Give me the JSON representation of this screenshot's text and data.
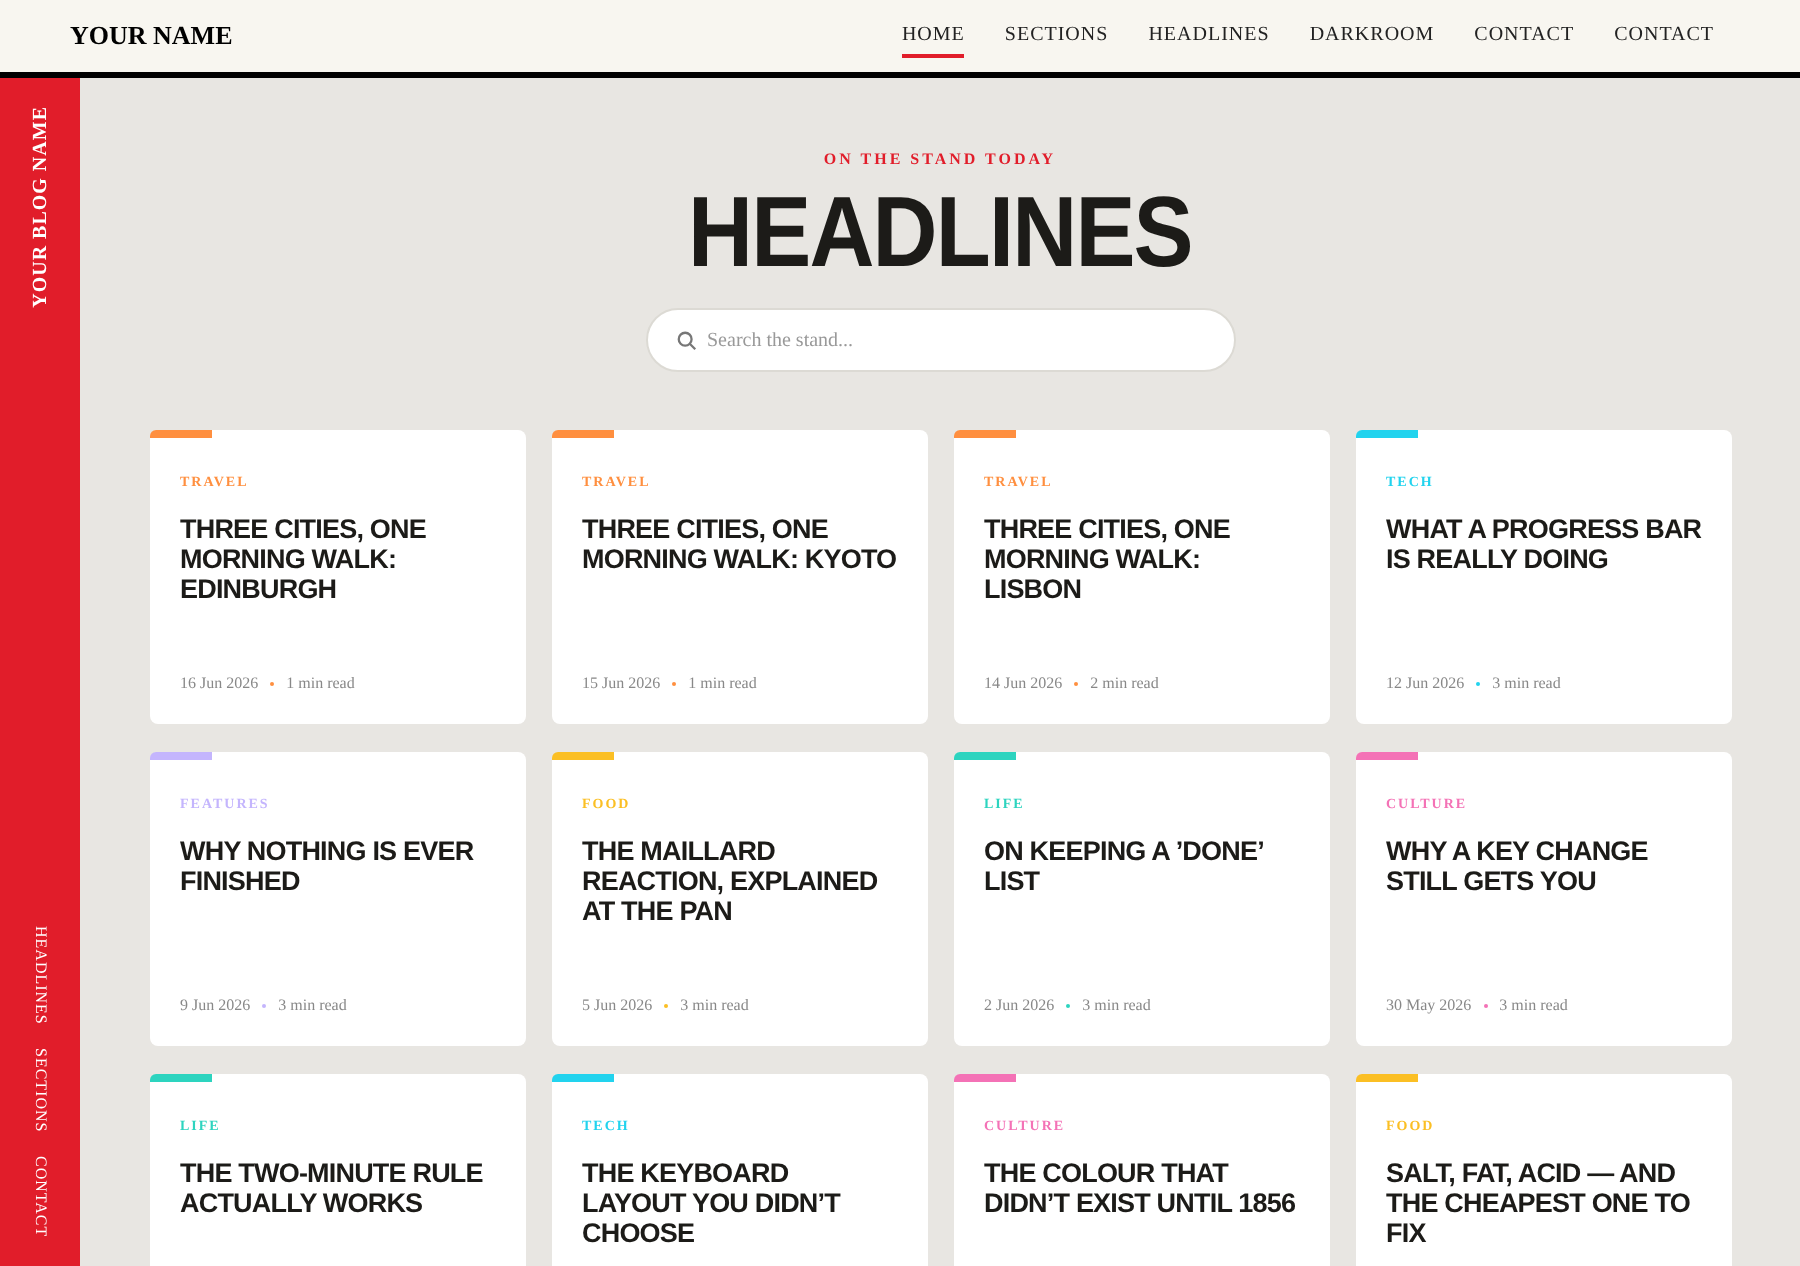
{
  "header": {
    "brand": "YOUR NAME",
    "nav": [
      {
        "label": "HOME",
        "selected": true
      },
      {
        "label": "SECTIONS",
        "selected": false
      },
      {
        "label": "HEADLINES",
        "selected": false
      },
      {
        "label": "DARKROOM",
        "selected": false
      },
      {
        "label": "CONTACT",
        "selected": false
      },
      {
        "label": "CONTACT",
        "selected": false
      }
    ]
  },
  "sidebar": {
    "blog_name": "YOUR BLOG NAME",
    "links": [
      "HEADLINES",
      "SECTIONS",
      "CONTACT"
    ]
  },
  "hero": {
    "kicker": "ON THE STAND TODAY",
    "title": "HEADLINES",
    "search": {
      "placeholder": "Search the stand..."
    }
  },
  "cards": [
    {
      "category": "TRAVEL",
      "color": "#ff8f3f",
      "title": "THREE CITIES, ONE MORNING WALK: EDINBURGH",
      "date": "16 Jun 2026",
      "read_time": "1 min read"
    },
    {
      "category": "TRAVEL",
      "color": "#ff8f3f",
      "title": "THREE CITIES, ONE MORNING WALK: KYOTO",
      "date": "15 Jun 2026",
      "read_time": "1 min read"
    },
    {
      "category": "TRAVEL",
      "color": "#ff8f3f",
      "title": "THREE CITIES, ONE MORNING WALK: LISBON",
      "date": "14 Jun 2026",
      "read_time": "2 min read"
    },
    {
      "category": "TECH",
      "color": "#22d3ee",
      "title": "WHAT A PROGRESS BAR IS REALLY DOING",
      "date": "12 Jun 2026",
      "read_time": "3 min read"
    },
    {
      "category": "FEATURES",
      "color": "#c4b5fd",
      "title": "WHY NOTHING IS EVER FINISHED",
      "date": "9 Jun 2026",
      "read_time": "3 min read"
    },
    {
      "category": "FOOD",
      "color": "#fbbf24",
      "title": "THE MAILLARD REACTION, EXPLAINED AT THE PAN",
      "date": "5 Jun 2026",
      "read_time": "3 min read"
    },
    {
      "category": "LIFE",
      "color": "#2dd4bf",
      "title": "ON KEEPING A ’DONE’ LIST",
      "date": "2 Jun 2026",
      "read_time": "3 min read"
    },
    {
      "category": "CULTURE",
      "color": "#f472b6",
      "title": "WHY A KEY CHANGE STILL GETS YOU",
      "date": "30 May 2026",
      "read_time": "3 min read"
    },
    {
      "category": "LIFE",
      "color": "#2dd4bf",
      "title": "THE TWO-MINUTE RULE ACTUALLY WORKS"
    },
    {
      "category": "TECH",
      "color": "#22d3ee",
      "title": "THE KEYBOARD LAYOUT YOU DIDN’T CHOOSE"
    },
    {
      "category": "CULTURE",
      "color": "#f472b6",
      "title": "THE COLOUR THAT DIDN’T EXIST UNTIL 1856"
    },
    {
      "category": "FOOD",
      "color": "#fbbf24",
      "title": "SALT, FAT, ACID — AND THE CHEAPEST ONE TO FIX"
    }
  ]
}
